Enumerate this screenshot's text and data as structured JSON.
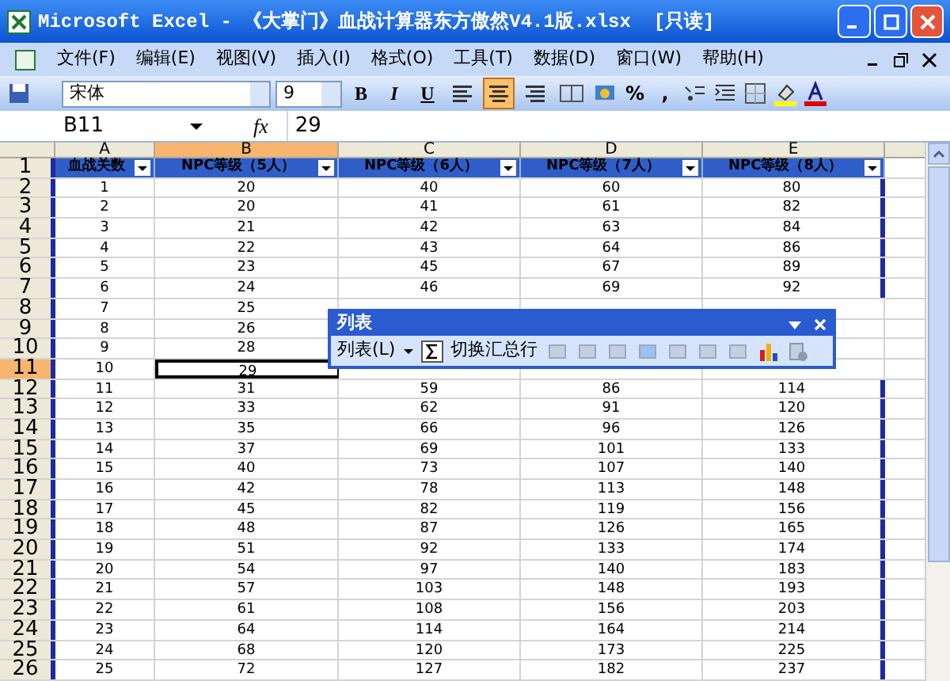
{
  "window": {
    "title": "Microsoft Excel - 《大掌门》血战计算器东方傲然V4.1版.xlsx  [只读]"
  },
  "menu": [
    "文件(F)",
    "编辑(E)",
    "视图(V)",
    "插入(I)",
    "格式(O)",
    "工具(T)",
    "数据(D)",
    "窗口(W)",
    "帮助(H)"
  ],
  "toolbar": {
    "font": "宋体",
    "size": "9",
    "bold": "B",
    "italic": "I",
    "underline": "U",
    "align": [
      {
        "kind": "left",
        "selected": false
      },
      {
        "kind": "center",
        "selected": true
      },
      {
        "kind": "right",
        "selected": false
      },
      {
        "kind": "merge",
        "selected": false
      }
    ],
    "percent": "%",
    "comma": ","
  },
  "formula_bar": {
    "name_box": "B11",
    "fx": "fx",
    "value": "29"
  },
  "columns": [
    {
      "letter": "A",
      "selected": false
    },
    {
      "letter": "B",
      "selected": true
    },
    {
      "letter": "C",
      "selected": false
    },
    {
      "letter": "D",
      "selected": false
    },
    {
      "letter": "E",
      "selected": false
    }
  ],
  "header_row": {
    "number": "1",
    "cells": [
      "血战关数",
      "NPC等级（5人）",
      "NPC等级（6人）",
      "NPC等级（7人）",
      "NPC等级（8人）"
    ]
  },
  "rows": [
    {
      "number": "2",
      "selected": false,
      "cells": [
        "1",
        "20",
        "40",
        "60",
        "80"
      ]
    },
    {
      "number": "3",
      "selected": false,
      "cells": [
        "2",
        "20",
        "41",
        "61",
        "82"
      ]
    },
    {
      "number": "4",
      "selected": false,
      "cells": [
        "3",
        "21",
        "42",
        "63",
        "84"
      ]
    },
    {
      "number": "5",
      "selected": false,
      "cells": [
        "4",
        "22",
        "43",
        "64",
        "86"
      ]
    },
    {
      "number": "6",
      "selected": false,
      "cells": [
        "5",
        "23",
        "45",
        "67",
        "89"
      ]
    },
    {
      "number": "7",
      "selected": false,
      "cells": [
        "6",
        "24",
        "46",
        "69",
        "92"
      ]
    },
    {
      "number": "8",
      "selected": false,
      "cells": [
        "7",
        "25"
      ]
    },
    {
      "number": "9",
      "selected": false,
      "cells": [
        "8",
        "26"
      ]
    },
    {
      "number": "10",
      "selected": false,
      "cells": [
        "9",
        "28"
      ]
    },
    {
      "number": "11",
      "selected": true,
      "cells": [
        "10",
        "29"
      ]
    },
    {
      "number": "12",
      "selected": false,
      "cells": [
        "11",
        "31",
        "59",
        "86",
        "114"
      ]
    },
    {
      "number": "13",
      "selected": false,
      "cells": [
        "12",
        "33",
        "62",
        "91",
        "120"
      ]
    },
    {
      "number": "14",
      "selected": false,
      "cells": [
        "13",
        "35",
        "66",
        "96",
        "126"
      ]
    },
    {
      "number": "15",
      "selected": false,
      "cells": [
        "14",
        "37",
        "69",
        "101",
        "133"
      ]
    },
    {
      "number": "16",
      "selected": false,
      "cells": [
        "15",
        "40",
        "73",
        "107",
        "140"
      ]
    },
    {
      "number": "17",
      "selected": false,
      "cells": [
        "16",
        "42",
        "78",
        "113",
        "148"
      ]
    },
    {
      "number": "18",
      "selected": false,
      "cells": [
        "17",
        "45",
        "82",
        "119",
        "156"
      ]
    },
    {
      "number": "19",
      "selected": false,
      "cells": [
        "18",
        "48",
        "87",
        "126",
        "165"
      ]
    },
    {
      "number": "20",
      "selected": false,
      "cells": [
        "19",
        "51",
        "92",
        "133",
        "174"
      ]
    },
    {
      "number": "21",
      "selected": false,
      "cells": [
        "20",
        "54",
        "97",
        "140",
        "183"
      ]
    },
    {
      "number": "22",
      "selected": false,
      "cells": [
        "21",
        "57",
        "103",
        "148",
        "193"
      ]
    },
    {
      "number": "23",
      "selected": false,
      "cells": [
        "22",
        "61",
        "108",
        "156",
        "203"
      ]
    },
    {
      "number": "24",
      "selected": false,
      "cells": [
        "23",
        "64",
        "114",
        "164",
        "214"
      ]
    },
    {
      "number": "25",
      "selected": false,
      "cells": [
        "24",
        "68",
        "120",
        "173",
        "225"
      ]
    },
    {
      "number": "26",
      "selected": false,
      "cells": [
        "25",
        "72",
        "127",
        "182",
        "237"
      ]
    }
  ],
  "list_toolbar": {
    "title": "列表",
    "menu": "列表(L)",
    "toggle_total": "切换汇总行"
  }
}
